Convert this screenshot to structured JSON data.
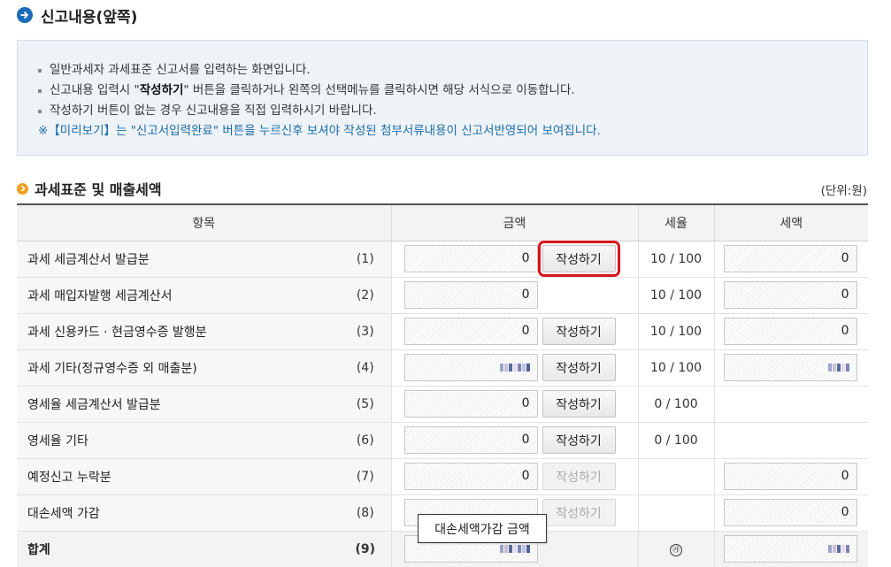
{
  "header": {
    "title": "신고내용(앞쪽)"
  },
  "info": {
    "line1": "일반과세자 과세표준 신고서를 입력하는 화면입니다.",
    "line2_pre": "신고내용 입력시 \"",
    "line2_bold": "작성하기",
    "line2_post": "\" 버튼을 클릭하거나 왼쪽의 선택메뉴를 클릭하시면 해당 서식으로 이동합니다.",
    "line3": "작성하기 버튼이 없는 경우 신고내용을 직접 입력하시기 바랍니다.",
    "note": "※【미리보기】는 \"신고서입력완료\" 버튼을 누르신후 보셔야 작성된 첨부서류내용이 신고서반영되어 보여집니다."
  },
  "section": {
    "title": "과세표준 및 매출세액",
    "unit": "(단위:원)"
  },
  "table": {
    "headers": {
      "item": "항목",
      "amount": "금액",
      "rate": "세율",
      "tax": "세액"
    },
    "write_label": "작성하기",
    "rows": [
      {
        "label": "과세 세금계산서 발급분",
        "num": "(1)",
        "amount": "0",
        "rate": "10 / 100",
        "tax": "0"
      },
      {
        "label": "과세 매입자발행 세금계산서",
        "num": "(2)",
        "amount": "0",
        "rate": "10 / 100",
        "tax": "0"
      },
      {
        "label": "과세 신용카드 · 현금영수증 발행분",
        "num": "(3)",
        "amount": "0",
        "rate": "10 / 100",
        "tax": "0"
      },
      {
        "label": "과세 기타(정규영수증 외 매출분)",
        "num": "(4)",
        "amount": "",
        "rate": "10 / 100",
        "tax": ""
      },
      {
        "label": "영세율 세금계산서 발급분",
        "num": "(5)",
        "amount": "0",
        "rate": "0 / 100",
        "tax": ""
      },
      {
        "label": "영세율 기타",
        "num": "(6)",
        "amount": "0",
        "rate": "0 / 100",
        "tax": ""
      },
      {
        "label": "예정신고 누락분",
        "num": "(7)",
        "amount": "0",
        "rate": "",
        "tax": "0"
      },
      {
        "label": "대손세액 가감",
        "num": "(8)",
        "amount": "",
        "rate": "",
        "tax": "0"
      },
      {
        "label": "합계",
        "num": "(9)",
        "amount": "",
        "rate": "㉮",
        "tax": ""
      }
    ]
  },
  "tooltip": "대손세액가감 금액",
  "colors": {
    "accent_blue": "#1a6bb8",
    "highlight_red": "#d9141c",
    "note_blue": "#1a6ba8",
    "section_orange": "#f0a020"
  }
}
